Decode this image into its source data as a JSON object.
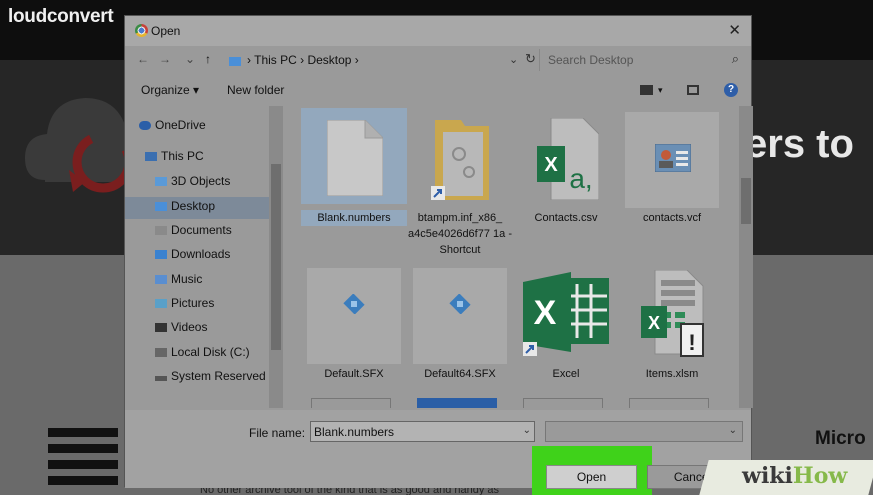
{
  "background": {
    "logo_text": "loudconvert",
    "hero_heading": "ers to",
    "section_heading": "Micro",
    "footer_text": "No other archive tool of the kind that is as good and handy as"
  },
  "dialog": {
    "title": "Open",
    "close_glyph": "✕",
    "nav": {
      "back": "←",
      "forward": "→",
      "recent": "⌄",
      "up": "↑",
      "breadcrumb": "› This PC › Desktop ›",
      "dropdown": "⌄",
      "refresh": "↻",
      "search_placeholder": "Search Desktop",
      "search_glyph": "⌕"
    },
    "toolbar": {
      "organize": "Organize ▾",
      "new_folder": "New folder",
      "view_dropdown": "▾",
      "help": "?"
    },
    "nav_pane": [
      {
        "label": "OneDrive",
        "icon": "cloud-icon",
        "color": "#2b5fa8"
      },
      {
        "label": "This PC",
        "icon": "computer-icon",
        "color": "#3b6fb0"
      },
      {
        "label": "3D Objects",
        "icon": "cube-icon",
        "color": "#5a9ad8"
      },
      {
        "label": "Desktop",
        "icon": "desktop-icon",
        "color": "#4a8fd8",
        "selected": true
      },
      {
        "label": "Documents",
        "icon": "document-icon",
        "color": "#8a8a8a"
      },
      {
        "label": "Downloads",
        "icon": "download-icon",
        "color": "#3a82d0"
      },
      {
        "label": "Music",
        "icon": "music-icon",
        "color": "#5a8ed0"
      },
      {
        "label": "Pictures",
        "icon": "pictures-icon",
        "color": "#5aa0c8"
      },
      {
        "label": "Videos",
        "icon": "video-icon",
        "color": "#333333"
      },
      {
        "label": "Local Disk (C:)",
        "icon": "disk-icon",
        "color": "#666666"
      },
      {
        "label": "System Reserved",
        "icon": "drive-icon",
        "color": "#555555"
      }
    ],
    "files": [
      {
        "name": "Blank.numbers",
        "icon": "blank-file-icon",
        "selected": true
      },
      {
        "name": "btampm.inf_x86_ a4c5e4026d6f77 1a - Shortcut",
        "icon": "folder-shortcut-icon"
      },
      {
        "name": "Contacts.csv",
        "icon": "excel-csv-icon"
      },
      {
        "name": "contacts.vcf",
        "icon": "contact-card-icon"
      },
      {
        "name": "Default.SFX",
        "icon": "sfx-file-icon"
      },
      {
        "name": "Default64.SFX",
        "icon": "sfx-file-icon"
      },
      {
        "name": "Excel",
        "icon": "excel-shortcut-icon"
      },
      {
        "name": "Items.xlsm",
        "icon": "excel-macro-icon"
      }
    ],
    "footer": {
      "file_name_label": "File name:",
      "file_name_value": "Blank.numbers",
      "file_type_value": "",
      "dropdown_glyph": "⌄",
      "open_label": "Open",
      "cancel_label": "Cancel"
    }
  },
  "watermark": {
    "part1": "wiki",
    "part2": "How"
  },
  "colors": {
    "highlight": "#3fd21a",
    "excel_green": "#1e7145",
    "selection": "#93a8bd"
  }
}
